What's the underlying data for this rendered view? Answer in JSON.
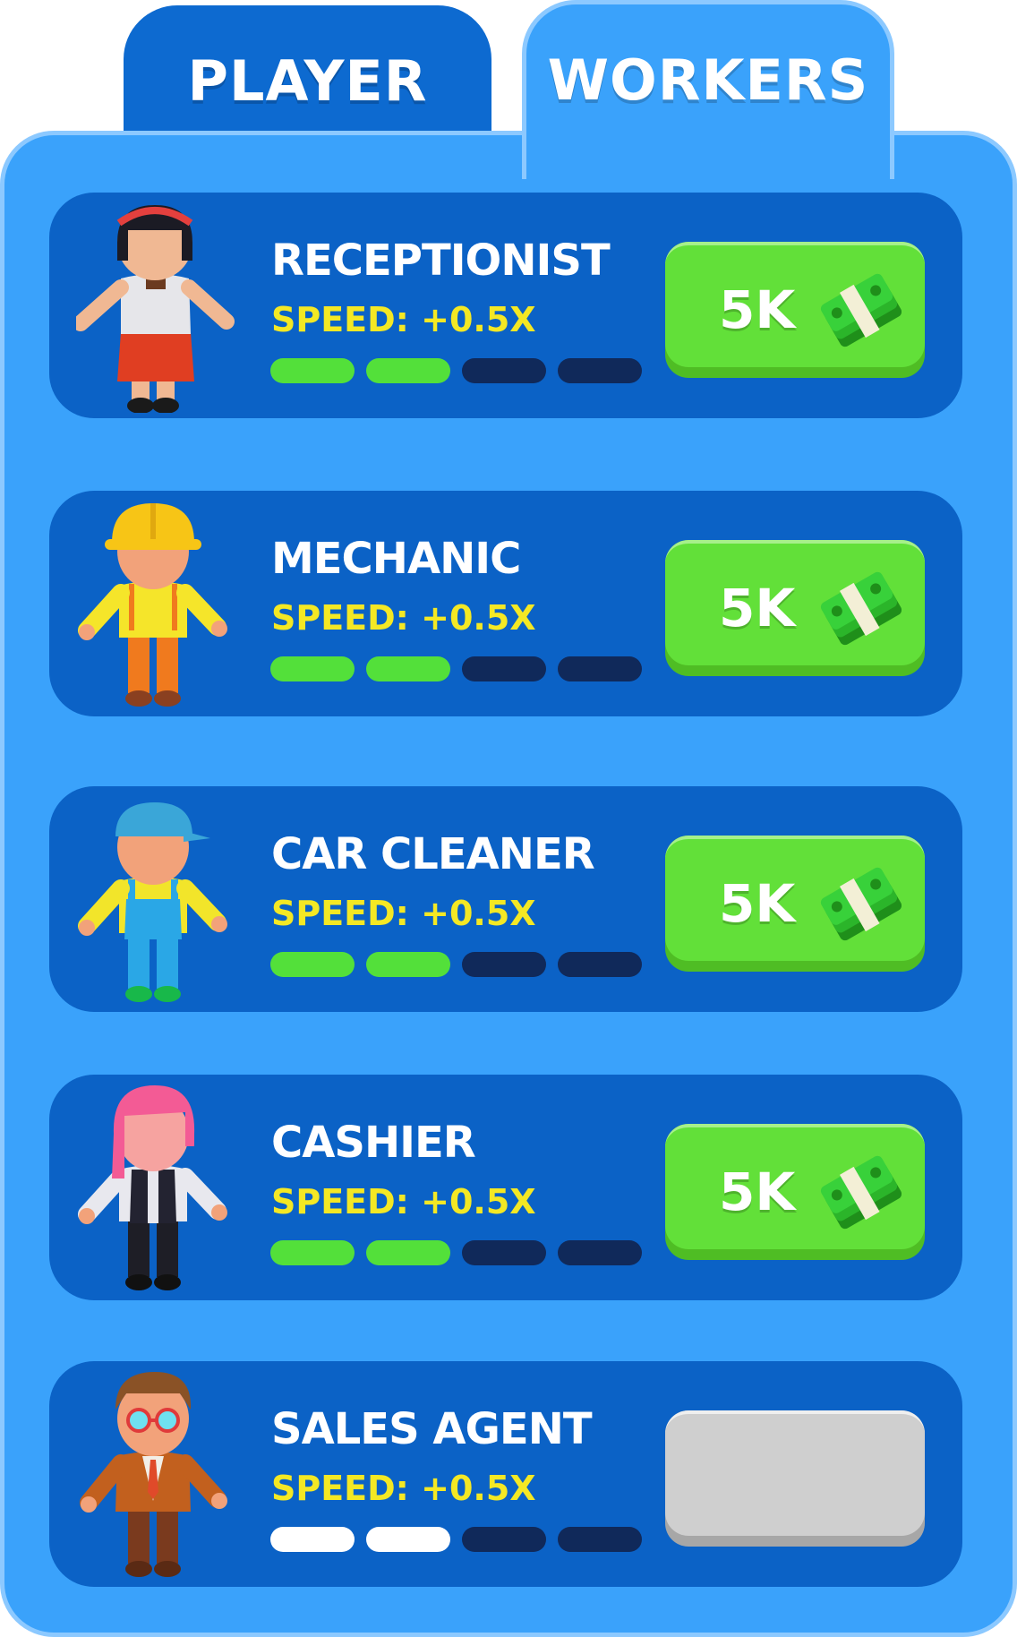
{
  "tabs": {
    "player": "PLAYER",
    "workers": "WORKERS"
  },
  "workers": [
    {
      "name": "RECEPTIONIST",
      "speed": "SPEED: +0.5X",
      "level": 2,
      "max_level": 4,
      "price": "5K",
      "locked": false
    },
    {
      "name": "MECHANIC",
      "speed": "SPEED: +0.5X",
      "level": 2,
      "max_level": 4,
      "price": "5K",
      "locked": false
    },
    {
      "name": "CAR CLEANER",
      "speed": "SPEED: +0.5X",
      "level": 2,
      "max_level": 4,
      "price": "5K",
      "locked": false
    },
    {
      "name": "CASHIER",
      "speed": "SPEED: +0.5X",
      "level": 2,
      "max_level": 4,
      "price": "5K",
      "locked": false
    },
    {
      "name": "SALES AGENT",
      "speed": "SPEED: +0.5X",
      "level": 2,
      "max_level": 4,
      "price": "",
      "locked": true
    }
  ],
  "colors": {
    "panel": "#3aa2fb",
    "card": "#0b62c6",
    "tab_inactive": "#0d6ad0",
    "progress_on": "#53e03a",
    "progress_off": "#10295a",
    "speed_text": "#f4e824",
    "buy_button": "#62e039",
    "locked_button": "#cfcfcf"
  },
  "icons": {
    "receptionist": "receptionist-avatar-icon",
    "mechanic": "mechanic-avatar-icon",
    "car_cleaner": "car-cleaner-avatar-icon",
    "cashier": "cashier-avatar-icon",
    "sales_agent": "sales-agent-avatar-icon",
    "cash": "cash-stack-icon"
  }
}
